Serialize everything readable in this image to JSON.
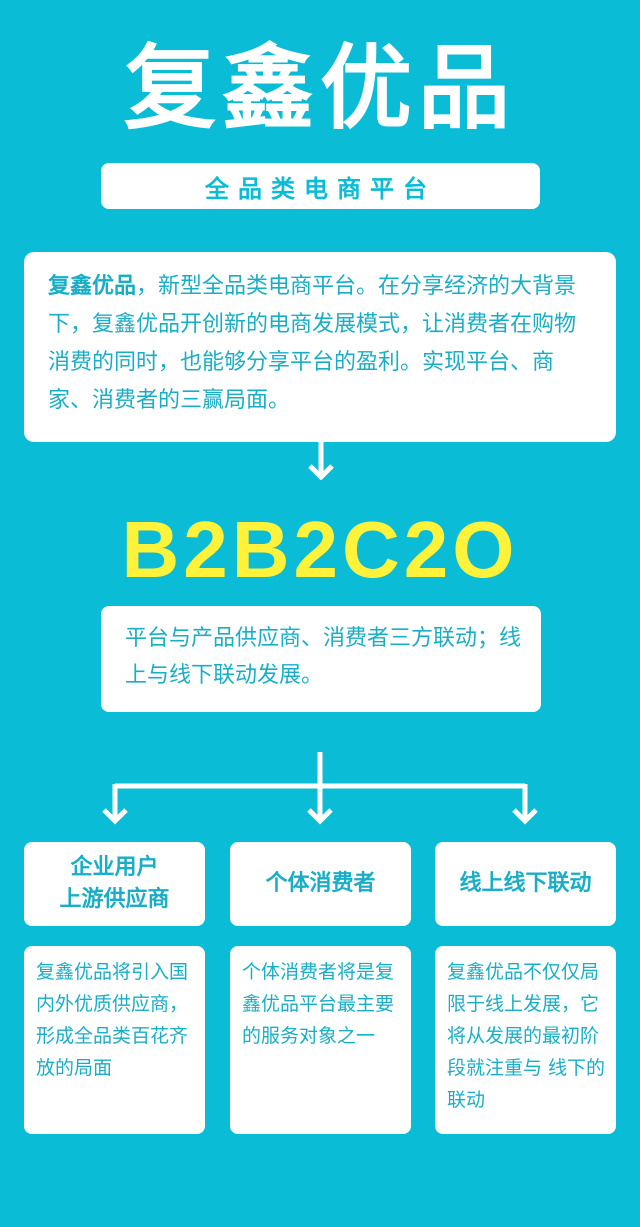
{
  "header": {
    "title": "复鑫优品",
    "subtitle": "全品类电商平台"
  },
  "intro": {
    "brand": "复鑫优品",
    "text": "，新型全品类电商平台。在分享经济的大背景下，复鑫优品开创新的电商发展模式，让消费者在购物消费的同时，也能够分享平台的盈利。实现平台、商家、消费者的三赢局面。"
  },
  "model": {
    "name": "B2B2C2O",
    "description": "平台与产品供应商、消费者三方联动；线上与线下联动发展。"
  },
  "columns": [
    {
      "heading_line1": "企业用户",
      "heading_line2": "上游供应商",
      "body": "复鑫优品将引入国内外优质供应商，形成全品类百花齐放的局面"
    },
    {
      "heading_line1": "个体消费者",
      "heading_line2": "",
      "body": "个体消费者将是复鑫优品平台最主要的服务对象之一"
    },
    {
      "heading_line1": "线上线下联动",
      "heading_line2": "",
      "body": "复鑫优品不仅仅局限于线上发展，它将从发展的最初阶段就注重与 线下的联动"
    }
  ],
  "colors": {
    "background": "#0bbcd6",
    "text_accent": "#1aaec6",
    "model_highlight": "#fff23a",
    "card": "#ffffff"
  }
}
